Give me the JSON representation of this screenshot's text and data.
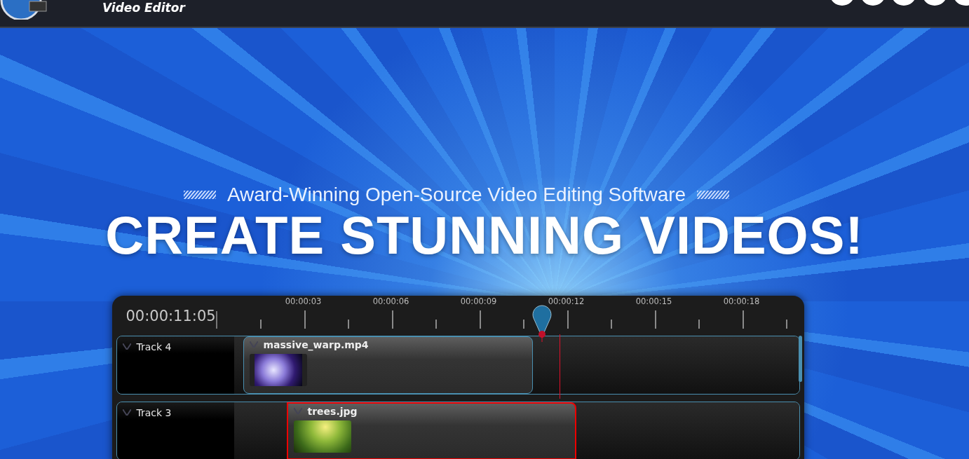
{
  "header": {
    "logo_subtitle": "Video Editor"
  },
  "hero": {
    "tagline": "Award-Winning Open-Source Video Editing Software",
    "headline": "CREATE STUNNING VIDEOS!"
  },
  "timeline": {
    "current_time": "00:00:11:05",
    "ruler_labels": [
      "00:00:03",
      "00:00:06",
      "00:00:09",
      "00:00:12",
      "00:00:15",
      "00:00:18"
    ],
    "tracks": [
      {
        "name": "Track 4",
        "clip": {
          "name": "massive_warp.mp4",
          "kind": "video",
          "selected": false
        }
      },
      {
        "name": "Track 3",
        "clip": {
          "name": "trees.jpg",
          "kind": "image",
          "selected": true
        }
      }
    ]
  }
}
